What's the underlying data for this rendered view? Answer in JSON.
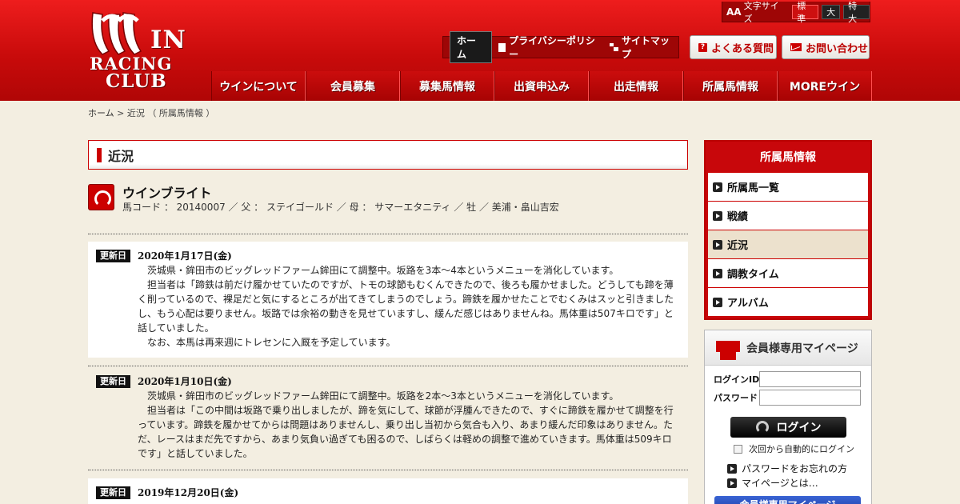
{
  "logo": {
    "line1": "IN",
    "line2": "RACING",
    "line3": "CLUB"
  },
  "fontsize": {
    "label": "文字サイズ",
    "prefix": "AA",
    "options": [
      "標準",
      "大",
      "特大"
    ],
    "active": "標準"
  },
  "subnav": {
    "home": "ホーム",
    "privacy": "プライバシーポリシー",
    "sitemap": "サイトマップ"
  },
  "topbuttons": {
    "faq": "よくある質問",
    "contact": "お問い合わせ"
  },
  "mainnav": [
    "ウインについて",
    "会員募集",
    "募集馬情報",
    "出資申込み",
    "出走情報",
    "所属馬情報",
    "MOREウイン"
  ],
  "breadcrumb": {
    "home": "ホーム",
    "sep1": " > ",
    "current": "近況 （ 所属馬情報 ）"
  },
  "section_title": "近況",
  "horse": {
    "name": "ウインブライト",
    "info": "馬コード ： 20140007 ／ 父 ： ステイゴールド ／ 母 ： サマーエタニティ ／ 牡 ／ 美浦・畠山吉宏"
  },
  "badge_label": "更新日",
  "entries": [
    {
      "date": "2020年1月17日(金)",
      "paragraphs": [
        "茨城県・鉾田市のビッグレッドファーム鉾田にて調整中。坂路を3本～4本というメニューを消化しています。",
        "担当者は「蹄鉄は前だけ履かせていたのですが、トモの球節もむくんできたので、後ろも履かせました。どうしても蹄を薄く削っているので、裸足だと気にするところが出てきてしまうのでしょう。蹄鉄を履かせたことでむくみはスッと引きましたし、もう心配は要りません。坂路では余裕の動きを見せていますし、緩んだ感じはありませんね。馬体重は507キロです」と話していました。",
        "なお、本馬は再来週にトレセンに入厩を予定しています。"
      ]
    },
    {
      "date": "2020年1月10日(金)",
      "paragraphs": [
        "茨城県・鉾田市のビッグレッドファーム鉾田にて調整中。坂路を2本～3本というメニューを消化しています。",
        "担当者は「この中間は坂路で乗り出しましたが、蹄を気にして、球節が浮腫んできたので、すぐに蹄鉄を履かせて調整を行っています。蹄鉄を履かせてからは問題はありませんし、乗り出し当初から気合も入り、あまり緩んだ印象はありません。ただ、レースはまだ先ですから、あまり気負い過ぎても困るので、しばらくは軽めの調整で進めていきます。馬体重は509キロです」と話していました。"
      ]
    },
    {
      "date": "2019年12月20日(金)",
      "paragraphs": []
    }
  ],
  "sidebar": {
    "title": "所属馬情報",
    "items": [
      "所属馬一覧",
      "戦績",
      "近況",
      "調教タイム",
      "アルバム"
    ],
    "current": "近況"
  },
  "login": {
    "title": "会員様専用マイページ",
    "id_label": "ログインID",
    "pw_label": "パスワード",
    "button": "ログイン",
    "auto": "次回から自動的にログイン",
    "forgot": "パスワードをお忘れの方",
    "about": "マイページとは…",
    "mypage_button": "会員様専用マイページ"
  },
  "colors": {
    "brand_red": "#c8070b",
    "header_red": "#e11414",
    "beige": "#f3eee1",
    "current_item": "#ece1cd"
  }
}
